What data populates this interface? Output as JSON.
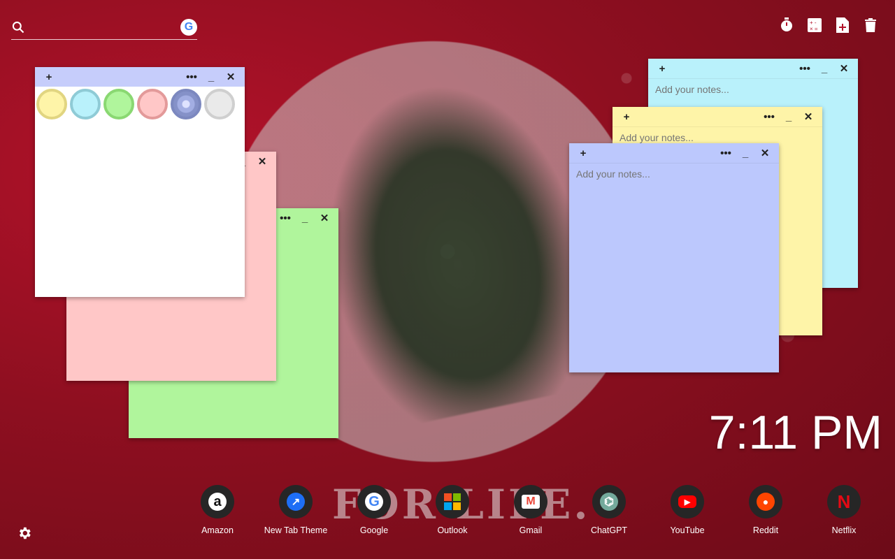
{
  "search": {
    "placeholder": "",
    "engine_badge": "G"
  },
  "top_icons": [
    "timer-icon",
    "calculator-icon",
    "add-note-icon",
    "trash-icon"
  ],
  "notes": [
    {
      "placeholder": "Add your notes...",
      "color": "#b9f1fb",
      "bar_color": "#b9f1fb"
    },
    {
      "placeholder": "Add your notes...",
      "color": "#fef4a8",
      "bar_color": "#fef4a8"
    },
    {
      "placeholder": "Add your notes...",
      "color": "#bcc8fd",
      "bar_color": "#bcc8fd"
    }
  ],
  "note_controls": {
    "add": "+",
    "more": "•••",
    "minimize": "_",
    "close": "✕"
  },
  "swatch_colors": [
    "#fef4a8",
    "#b9f1fb",
    "#b0f59c",
    "#ffc7c7",
    "#8a97c9",
    "#eaeaea"
  ],
  "clock": "7:11 PM",
  "background_text": "FOR LIFE.",
  "dock": [
    {
      "label": "Amazon",
      "glyph": "a"
    },
    {
      "label": "New Tab Theme",
      "glyph": "↗"
    },
    {
      "label": "Google",
      "glyph": "G"
    },
    {
      "label": "Outlook",
      "glyph": "⊞"
    },
    {
      "label": "Gmail",
      "glyph": "M"
    },
    {
      "label": "ChatGPT",
      "glyph": "⌬"
    },
    {
      "label": "YouTube",
      "glyph": "▶"
    },
    {
      "label": "Reddit",
      "glyph": "●"
    },
    {
      "label": "Netflix",
      "glyph": "N"
    }
  ]
}
